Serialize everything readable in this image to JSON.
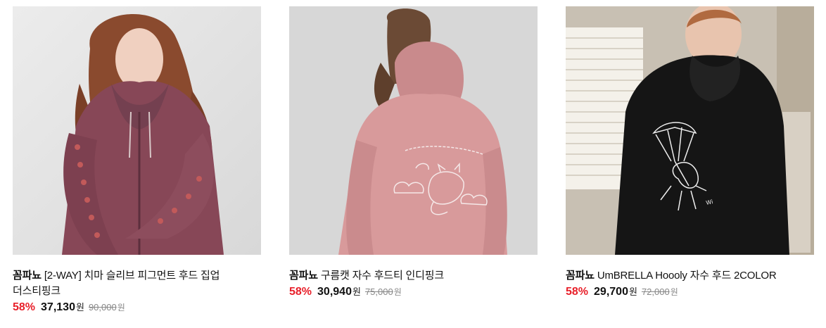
{
  "products": [
    {
      "brand": "꼼파뇨",
      "name": "[2-WAY] 치마 슬리브 피그먼트 후드 집업 더스티핑크",
      "discount": "58%",
      "sale_price": "37,130",
      "sale_unit": "원",
      "original_price": "90,000",
      "original_unit": "원",
      "image_desc": "product-photo-dusty-pink-zip-hoodie",
      "colors": {
        "garment": "#8a4a58",
        "background": "#e7e7e7"
      }
    },
    {
      "brand": "꼼파뇨",
      "name": "구름캣 자수 후드티 인디핑크",
      "discount": "58%",
      "sale_price": "30,940",
      "sale_unit": "원",
      "original_price": "75,000",
      "original_unit": "원",
      "image_desc": "product-photo-indi-pink-hoodie-back",
      "colors": {
        "garment": "#d99a9a",
        "background": "#d6d6d6"
      }
    },
    {
      "brand": "꼼파뇨",
      "name": "UmBRELLA Hoooly 자수 후드 2COLOR",
      "discount": "58%",
      "sale_price": "29,700",
      "sale_unit": "원",
      "original_price": "72,000",
      "original_unit": "원",
      "image_desc": "product-photo-black-hoodie-back",
      "colors": {
        "garment": "#151515",
        "background": "#c9c1b4"
      }
    }
  ],
  "accent_colors": {
    "discount": "#e8202a",
    "strikethrough": "#888888"
  }
}
